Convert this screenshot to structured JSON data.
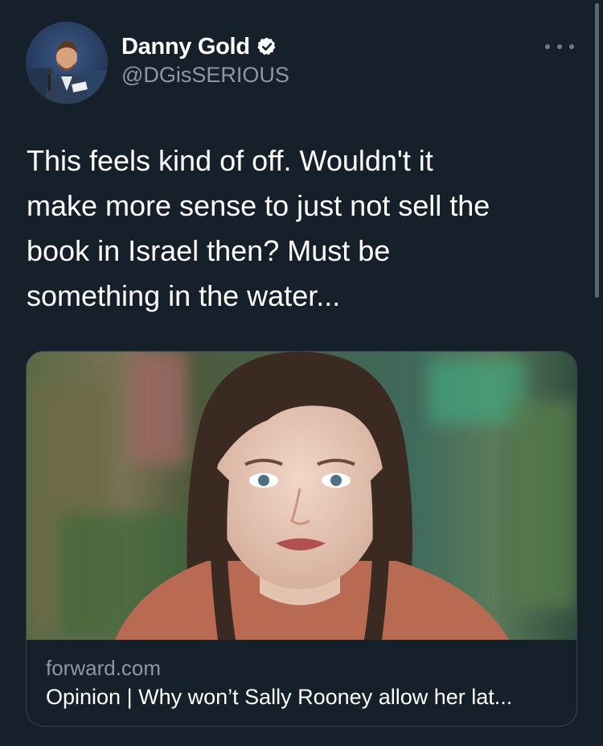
{
  "author": {
    "name": "Danny Gold",
    "handle": "@DGisSERIOUS",
    "verified": true,
    "avatar_icon": "profile-photo"
  },
  "more_icon": "more-options-icon",
  "tweet": {
    "text": "This feels kind of off. Wouldn't it\nmake more sense to just not sell the\nbook in Israel then? Must be\nsomething in the water..."
  },
  "link_card": {
    "image_icon": "portrait-photo",
    "domain": "forward.com",
    "title": "Opinion | Why won’t Sally Rooney allow her lat..."
  },
  "colors": {
    "background": "#15202b",
    "text_primary": "#ffffff",
    "text_secondary": "#8b98a5",
    "border": "#38444d",
    "verified_badge": "#ffffff"
  }
}
